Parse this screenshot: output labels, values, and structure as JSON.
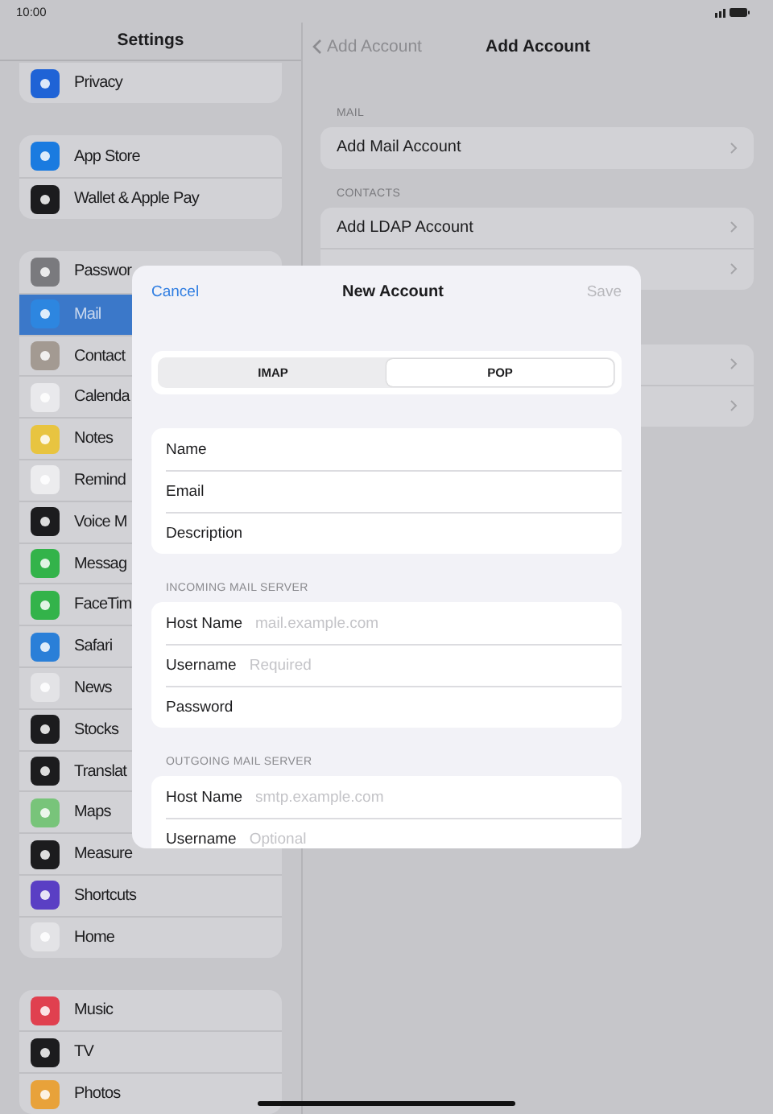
{
  "status_bar": {
    "time": "10:00"
  },
  "sidebar": {
    "title": "Settings",
    "groups": [
      {
        "items": [
          {
            "label": "Privacy",
            "color": "#1f63d6",
            "selected": false
          }
        ]
      },
      {
        "items": [
          {
            "label": "App Store",
            "color": "#1a7be0",
            "selected": false
          },
          {
            "label": "Wallet & Apple Pay",
            "color": "#1c1c1e",
            "selected": false
          }
        ]
      },
      {
        "items": [
          {
            "label": "Passwor",
            "color": "#7a7a7e",
            "selected": false
          },
          {
            "label": "Mail",
            "color": "#2d86e0",
            "selected": true
          },
          {
            "label": "Contact",
            "color": "#a39a92",
            "selected": false
          },
          {
            "label": "Calenda",
            "color": "#e9e9ec",
            "selected": false
          },
          {
            "label": "Notes",
            "color": "#e8c440",
            "selected": false
          },
          {
            "label": "Remind",
            "color": "#ececee",
            "selected": false
          },
          {
            "label": "Voice M",
            "color": "#1c1c1e",
            "selected": false
          },
          {
            "label": "Messag",
            "color": "#33b34a",
            "selected": false
          },
          {
            "label": "FaceTim",
            "color": "#33b34a",
            "selected": false
          },
          {
            "label": "Safari",
            "color": "#2a7fd8",
            "selected": false
          },
          {
            "label": "News",
            "color": "#e3e3e6",
            "selected": false
          },
          {
            "label": "Stocks",
            "color": "#1c1c1e",
            "selected": false
          },
          {
            "label": "Translat",
            "color": "#1c1c1e",
            "selected": false
          },
          {
            "label": "Maps",
            "color": "#78c47a",
            "selected": false
          },
          {
            "label": "Measure",
            "color": "#1c1c1e",
            "selected": false
          },
          {
            "label": "Shortcuts",
            "color": "#5a3fc4",
            "selected": false
          },
          {
            "label": "Home",
            "color": "#e3e3e6",
            "selected": false
          }
        ]
      },
      {
        "items": [
          {
            "label": "Music",
            "color": "#e0404f",
            "selected": false
          },
          {
            "label": "TV",
            "color": "#1c1c1e",
            "selected": false
          },
          {
            "label": "Photos",
            "color": "#e8a23a",
            "selected": false
          }
        ]
      }
    ]
  },
  "detail": {
    "back": "Add Account",
    "title": "Add Account",
    "sections": [
      {
        "header": "MAIL",
        "rows": [
          {
            "label": "Add Mail Account"
          }
        ]
      },
      {
        "header": "CONTACTS",
        "rows": [
          {
            "label": "Add LDAP Account"
          },
          {}
        ]
      },
      {
        "rows": [
          {},
          {}
        ]
      }
    ]
  },
  "modal": {
    "cancel": "Cancel",
    "title": "New Account",
    "save": {
      "label": "Save",
      "disabled": true
    },
    "segments": [
      {
        "label": "IMAP",
        "selected": false
      },
      {
        "label": "POP",
        "selected": true
      }
    ],
    "sections": [
      {
        "rows": [
          {
            "label": "Name"
          },
          {
            "label": "Email"
          },
          {
            "label": "Description"
          }
        ]
      },
      {
        "header": "INCOMING MAIL SERVER",
        "rows": [
          {
            "label": "Host Name",
            "placeholder": "mail.example.com"
          },
          {
            "label": "Username",
            "placeholder": "Required"
          },
          {
            "label": "Password"
          }
        ]
      },
      {
        "header": "OUTGOING MAIL SERVER",
        "rows": [
          {
            "label": "Host Name",
            "placeholder": "smtp.example.com"
          },
          {
            "label": "Username",
            "placeholder": "Optional"
          }
        ]
      }
    ]
  }
}
